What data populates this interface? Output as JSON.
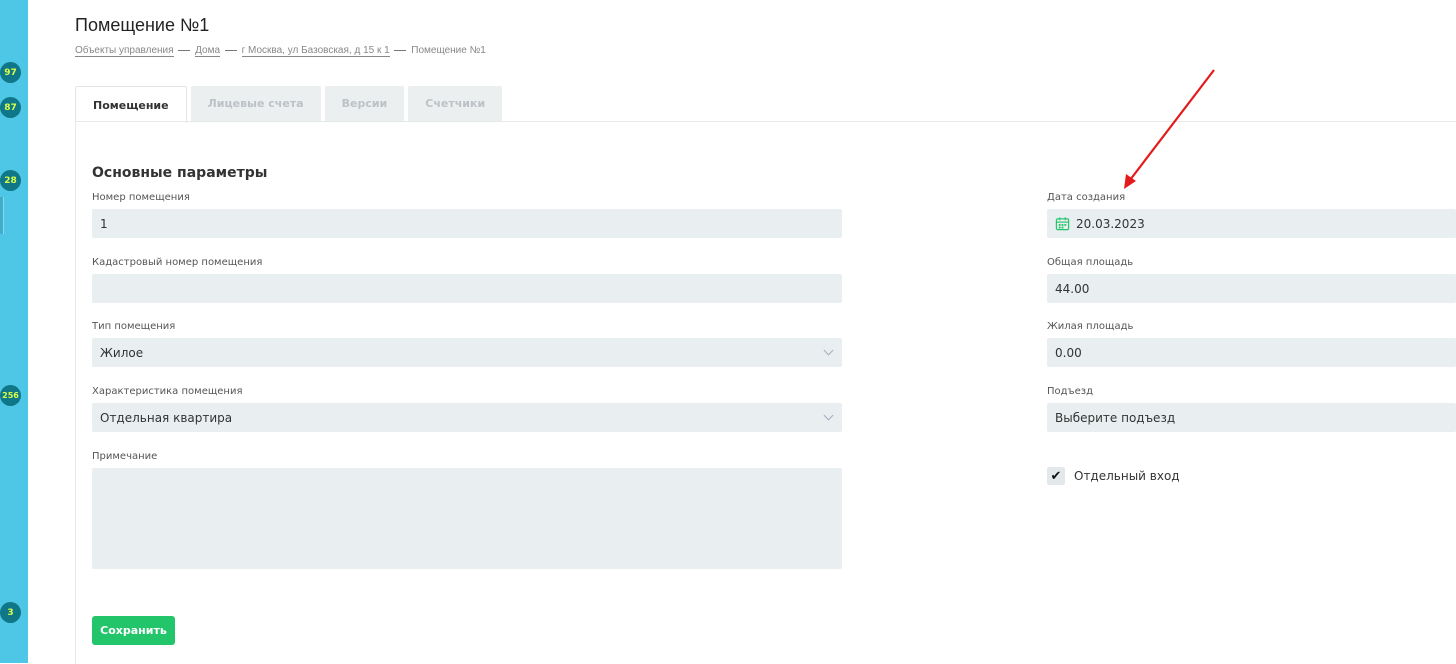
{
  "sidebar": {
    "badges": [
      "97",
      "87",
      "28",
      "256",
      "3"
    ]
  },
  "page": {
    "title": "Помещение №1",
    "breadcrumb": [
      "Объекты управления",
      "Дома",
      "г Москва, ул Базовская, д 15 к 1",
      "Помещение №1"
    ]
  },
  "tabs": [
    "Помещение",
    "Лицевые счета",
    "Версии",
    "Счетчики"
  ],
  "form": {
    "section_title": "Основные параметры",
    "room_number_label": "Номер помещения",
    "room_number_value": "1",
    "cadastral_label": "Кадастровый номер помещения",
    "cadastral_value": "",
    "room_type_label": "Тип помещения",
    "room_type_value": "Жилое",
    "characteristic_label": "Характеристика помещения",
    "characteristic_value": "Отдельная квартира",
    "note_label": "Примечание",
    "note_value": "",
    "created_label": "Дата создания",
    "created_value": "20.03.2023",
    "total_area_label": "Общая площадь",
    "total_area_value": "44.00",
    "living_area_label": "Жилая площадь",
    "living_area_value": "0.00",
    "entrance_label": "Подъезд",
    "entrance_value": "Выберите подъезд",
    "separate_entrance_label": "Отдельный вход",
    "separate_entrance_checked": true,
    "save_label": "Сохранить"
  },
  "colors": {
    "sidebar": "#4ec6e6",
    "badge": "#0f7787",
    "badge_text": "#d9ff47",
    "field_bg": "#e9eef0",
    "save_button": "#22c56a",
    "annotation_arrow": "#e41b1b"
  }
}
